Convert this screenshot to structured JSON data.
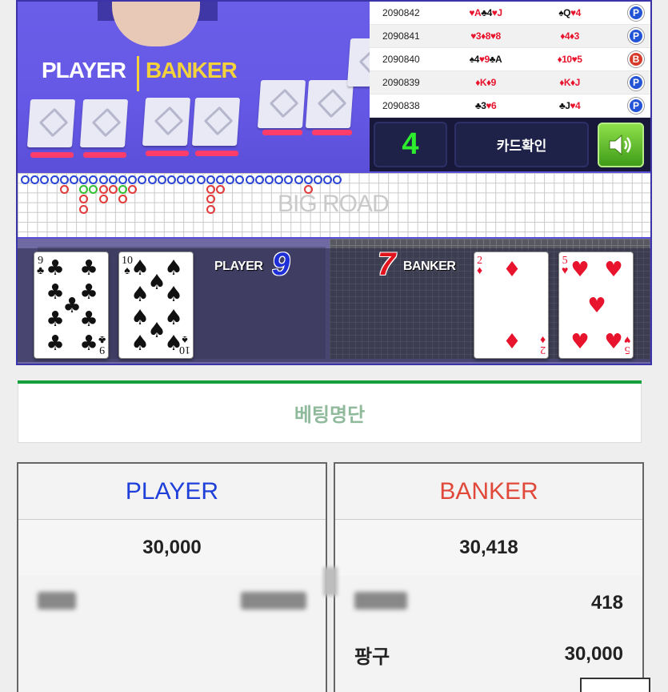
{
  "game": {
    "video": {
      "player_label": "PLAYER",
      "banker_label": "BANKER"
    },
    "results": [
      {
        "id": "2090842",
        "player": [
          [
            "♥",
            "A",
            "red"
          ],
          [
            "♣",
            "4",
            "blk"
          ],
          [
            "♥",
            "J",
            "red"
          ]
        ],
        "banker": [
          [
            "♠",
            "Q",
            "blk"
          ],
          [
            "♥",
            "4",
            "red"
          ]
        ],
        "winner": "P",
        "color": "#2454d6"
      },
      {
        "id": "2090841",
        "player": [
          [
            "♥",
            "3",
            "red"
          ],
          [
            "♦",
            "8",
            "red"
          ],
          [
            "♥",
            "8",
            "red"
          ]
        ],
        "banker": [
          [
            "♦",
            "4",
            "red"
          ],
          [
            "♦",
            "3",
            "red"
          ]
        ],
        "winner": "P",
        "color": "#2454d6"
      },
      {
        "id": "2090840",
        "player": [
          [
            "♠",
            "4",
            "blk"
          ],
          [
            "♥",
            "9",
            "red"
          ],
          [
            "♣",
            "A",
            "blk"
          ]
        ],
        "banker": [
          [
            "♦",
            "10",
            "red"
          ],
          [
            "♥",
            "5",
            "red"
          ]
        ],
        "winner": "B",
        "color": "#d63a2a"
      },
      {
        "id": "2090839",
        "player": [
          [
            "♦",
            "K",
            "red"
          ],
          [
            "♦",
            "9",
            "red"
          ]
        ],
        "banker": [
          [
            "♦",
            "K",
            "red"
          ],
          [
            "♦",
            "J",
            "red"
          ]
        ],
        "winner": "P",
        "color": "#2454d6"
      },
      {
        "id": "2090838",
        "player": [
          [
            "♣",
            "3",
            "blk"
          ],
          [
            "♥",
            "6",
            "red"
          ]
        ],
        "banker": [
          [
            "♣",
            "J",
            "blk"
          ],
          [
            "♥",
            "4",
            "red"
          ]
        ],
        "winner": "P",
        "color": "#2454d6"
      }
    ],
    "controls": {
      "count": "4",
      "confirm_label": "카드확인",
      "sound_icon": "speaker-icon"
    },
    "bigroad_label": "BIG ROAD",
    "result": {
      "player_label": "PLAYER",
      "player_score": "9",
      "player_color": "#1f2fd8",
      "banker_label": "BANKER",
      "banker_score": "7",
      "banker_color": "#e2141e",
      "player_cards": [
        {
          "rank": "9",
          "suit": "♣",
          "color": "#111"
        },
        {
          "rank": "10",
          "suit": "♠",
          "color": "#111"
        }
      ],
      "banker_cards": [
        {
          "rank": "2",
          "suit": "♦",
          "color": "#e8142d"
        },
        {
          "rank": "5",
          "suit": "♥",
          "color": "#e8142d"
        }
      ]
    }
  },
  "bets": {
    "title": "베팅명단",
    "player": {
      "label": "PLAYER",
      "color": "#1e3fd9",
      "total": "30,000",
      "rows": [
        {
          "name": "",
          "amount": ""
        }
      ]
    },
    "banker": {
      "label": "BANKER",
      "color": "#e0493a",
      "total": "30,418",
      "rows": [
        {
          "name": "",
          "amount": "418"
        },
        {
          "name": "팡구",
          "amount": "30,000"
        }
      ]
    }
  }
}
